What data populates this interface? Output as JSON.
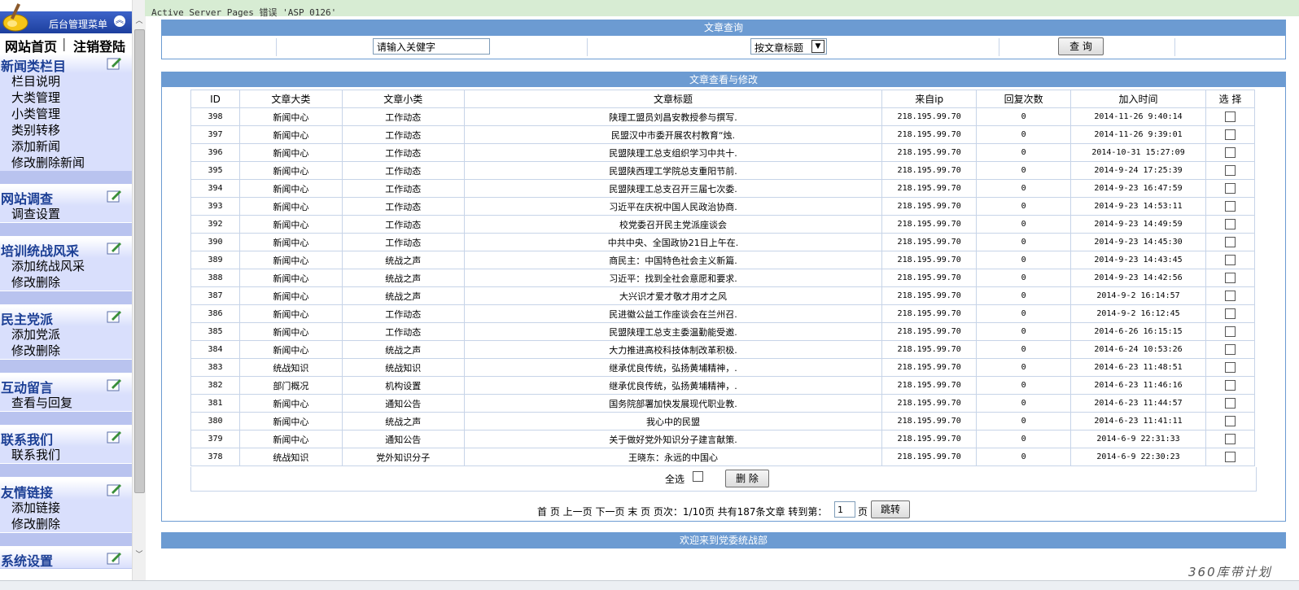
{
  "menu": {
    "title": "后台管理菜单",
    "home_link": "网站首页",
    "nav_separator": "|",
    "logout_link": "注销登陆",
    "sections": [
      {
        "title": "新闻类栏目",
        "items": [
          "栏目说明",
          "大类管理",
          "小类管理",
          "类别转移",
          "添加新闻",
          "修改删除新闻"
        ]
      },
      {
        "title": "网站调查",
        "items": [
          "调查设置"
        ]
      },
      {
        "title": "培训统战风采",
        "items": [
          "添加统战风采",
          "修改删除"
        ]
      },
      {
        "title": "民主党派",
        "items": [
          "添加党派",
          "修改删除"
        ]
      },
      {
        "title": "互动留言",
        "items": [
          "查看与回复"
        ]
      },
      {
        "title": "联系我们",
        "items": [
          "联系我们"
        ]
      },
      {
        "title": "友情链接",
        "items": [
          "添加链接",
          "修改删除"
        ]
      },
      {
        "title": "系统设置",
        "items": []
      }
    ]
  },
  "error_text": "Active Server Pages 错误 'ASP 0126'",
  "search": {
    "header": "文章查询",
    "keyword_value": "请输入关健字",
    "type_selected": "按文章标题",
    "submit_label": "查 询"
  },
  "list": {
    "header": "文章查看与修改",
    "columns": [
      "ID",
      "文章大类",
      "文章小类",
      "文章标题",
      "来自ip",
      "回复次数",
      "加入时间",
      "选 择"
    ],
    "rows": [
      [
        "398",
        "新闻中心",
        "工作动态",
        "陕理工盟员刘昌安教授参与撰写.",
        "218.195.99.70",
        "0",
        "2014-11-26 9:40:14"
      ],
      [
        "397",
        "新闻中心",
        "工作动态",
        "民盟汉中市委开展农村教育“烛.",
        "218.195.99.70",
        "0",
        "2014-11-26 9:39:01"
      ],
      [
        "396",
        "新闻中心",
        "工作动态",
        "民盟陕理工总支组织学习中共十.",
        "218.195.99.70",
        "0",
        "2014-10-31 15:27:09"
      ],
      [
        "395",
        "新闻中心",
        "工作动态",
        "民盟陕西理工学院总支重阳节前.",
        "218.195.99.70",
        "0",
        "2014-9-24 17:25:39"
      ],
      [
        "394",
        "新闻中心",
        "工作动态",
        "民盟陕理工总支召开三届七次委.",
        "218.195.99.70",
        "0",
        "2014-9-23 16:47:59"
      ],
      [
        "393",
        "新闻中心",
        "工作动态",
        "习近平在庆祝中国人民政治协商.",
        "218.195.99.70",
        "0",
        "2014-9-23 14:53:11"
      ],
      [
        "392",
        "新闻中心",
        "工作动态",
        "校党委召开民主党派座谈会",
        "218.195.99.70",
        "0",
        "2014-9-23 14:49:59"
      ],
      [
        "390",
        "新闻中心",
        "工作动态",
        "中共中央、全国政协21日上午在.",
        "218.195.99.70",
        "0",
        "2014-9-23 14:45:30"
      ],
      [
        "389",
        "新闻中心",
        "统战之声",
        "商民主：中国特色社会主义新篇.",
        "218.195.99.70",
        "0",
        "2014-9-23 14:43:45"
      ],
      [
        "388",
        "新闻中心",
        "统战之声",
        "习近平：找到全社会意愿和要求.",
        "218.195.99.70",
        "0",
        "2014-9-23 14:42:56"
      ],
      [
        "387",
        "新闻中心",
        "统战之声",
        "大兴识才爱才敬才用才之风",
        "218.195.99.70",
        "0",
        "2014-9-2 16:14:57"
      ],
      [
        "386",
        "新闻中心",
        "工作动态",
        "民进徽公益工作座谈会在兰州召.",
        "218.195.99.70",
        "0",
        "2014-9-2 16:12:45"
      ],
      [
        "385",
        "新闻中心",
        "工作动态",
        "民盟陕理工总支主委温勤能受邀.",
        "218.195.99.70",
        "0",
        "2014-6-26 16:15:15"
      ],
      [
        "384",
        "新闻中心",
        "统战之声",
        "大力推进高校科技体制改革积极.",
        "218.195.99.70",
        "0",
        "2014-6-24 10:53:26"
      ],
      [
        "383",
        "统战知识",
        "统战知识",
        "继承优良传统，弘扬黄埔精神，.",
        "218.195.99.70",
        "0",
        "2014-6-23 11:48:51"
      ],
      [
        "382",
        "部门概况",
        "机构设置",
        "继承优良传统，弘扬黄埔精神，.",
        "218.195.99.70",
        "0",
        "2014-6-23 11:46:16"
      ],
      [
        "381",
        "新闻中心",
        "通知公告",
        "国务院部署加快发展现代职业教.",
        "218.195.99.70",
        "0",
        "2014-6-23 11:44:57"
      ],
      [
        "380",
        "新闻中心",
        "统战之声",
        "我心中的民盟",
        "218.195.99.70",
        "0",
        "2014-6-23 11:41:11"
      ],
      [
        "379",
        "新闻中心",
        "通知公告",
        "关于做好党外知识分子建言献策.",
        "218.195.99.70",
        "0",
        "2014-6-9 22:31:33"
      ],
      [
        "378",
        "统战知识",
        "党外知识分子",
        "王晓东：永远的中国心",
        "218.195.99.70",
        "0",
        "2014-6-9 22:30:23"
      ]
    ],
    "select_all_label": "全选",
    "delete_label": "删 除"
  },
  "pager": {
    "text": "首 页  上一页  下一页  末 页  页次：1/10页  共有187条文章  转到第：",
    "page_value": "1",
    "page_suffix": "页",
    "jump_label": "跳转"
  },
  "footer": {
    "welcome": "欢迎来到党委统战部"
  },
  "watermark": "360库带计划",
  "colors": {
    "panel_header": "#6c9bd2",
    "menu_header": "#1d3f9e",
    "menu_body": "#d9dffc",
    "error_bar": "#d7ecd3"
  }
}
